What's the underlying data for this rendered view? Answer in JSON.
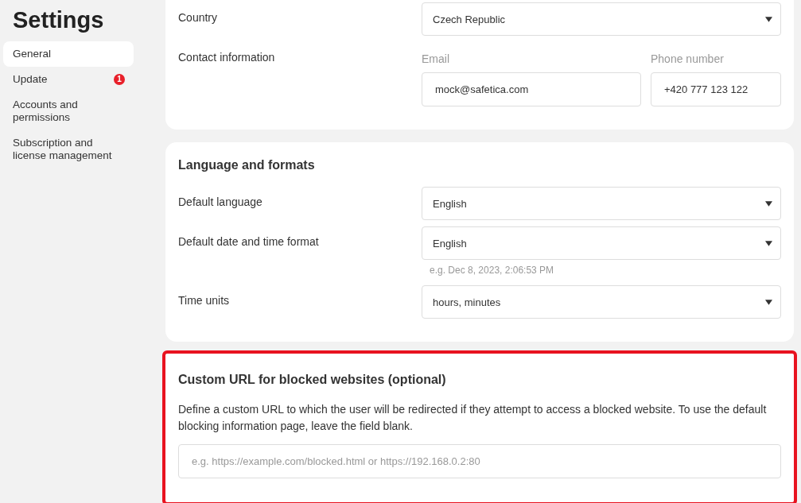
{
  "title": "Settings",
  "sidebar": {
    "items": [
      {
        "label": "General",
        "selected": true
      },
      {
        "label": "Update",
        "selected": false,
        "badge": "1"
      },
      {
        "label": "Accounts and permissions",
        "selected": false
      },
      {
        "label": "Subscription and license management",
        "selected": false
      }
    ]
  },
  "sections": [
    {
      "highlighted": false,
      "rows": [
        {
          "kind": "select",
          "label": "Country",
          "value": "Czech Republic"
        },
        {
          "kind": "contact",
          "label": "Contact information",
          "fields": [
            {
              "label": "Email",
              "value": "mock@safetica.com"
            },
            {
              "label": "Phone number",
              "value": "+420 777 123 122"
            }
          ]
        }
      ]
    },
    {
      "highlighted": false,
      "title": "Language and formats",
      "rows": [
        {
          "kind": "select",
          "label": "Default language",
          "value": "English"
        },
        {
          "kind": "select",
          "label": "Default date and time format",
          "value": "English",
          "hint": "e.g. Dec 8, 2023, 2:06:53 PM"
        },
        {
          "kind": "select",
          "label": "Time units",
          "value": "hours, minutes"
        }
      ]
    },
    {
      "highlighted": true,
      "title": "Custom URL for blocked websites (optional)",
      "description": "Define a custom URL to which the user will be redirected if they attempt to access a blocked website. To use the default blocking information page, leave the field blank.",
      "rows": [
        {
          "kind": "text_input",
          "placeholder": "e.g. https://example.com/blocked.html or https://192.168.0.2:80"
        }
      ]
    }
  ]
}
